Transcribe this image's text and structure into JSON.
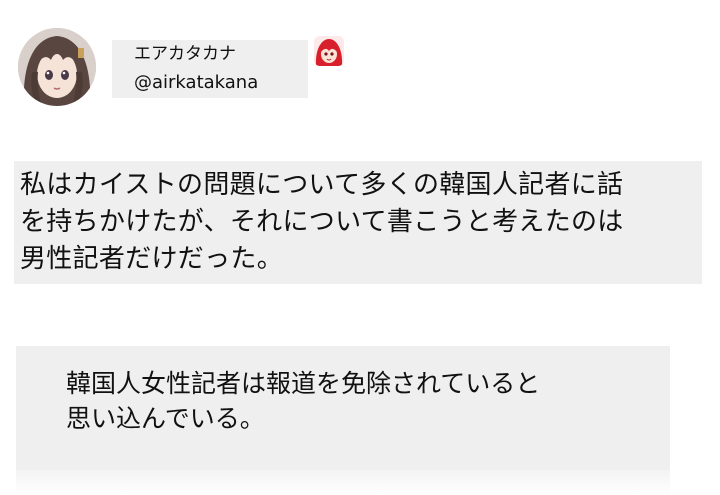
{
  "profile": {
    "display_name": "エアカタカナ",
    "handle": "@airkatakana",
    "avatar_icon": "anime-girl-avatar-icon",
    "badge_icon": "red-haired-anime-emoji-icon"
  },
  "tweet": {
    "lines": [
      "私はカイストの問題について多くの韓国人記者に話",
      "を持ちかけたが、それについて書こうと考えたのは",
      "男性記者だけだった。"
    ]
  },
  "quote": {
    "lines": [
      "韓国人女性記者は報道を免除されていると",
      "思い込んでいる。"
    ]
  },
  "colors": {
    "block_background": "#efefef",
    "page_background": "#ffffff",
    "text": "#111111"
  }
}
